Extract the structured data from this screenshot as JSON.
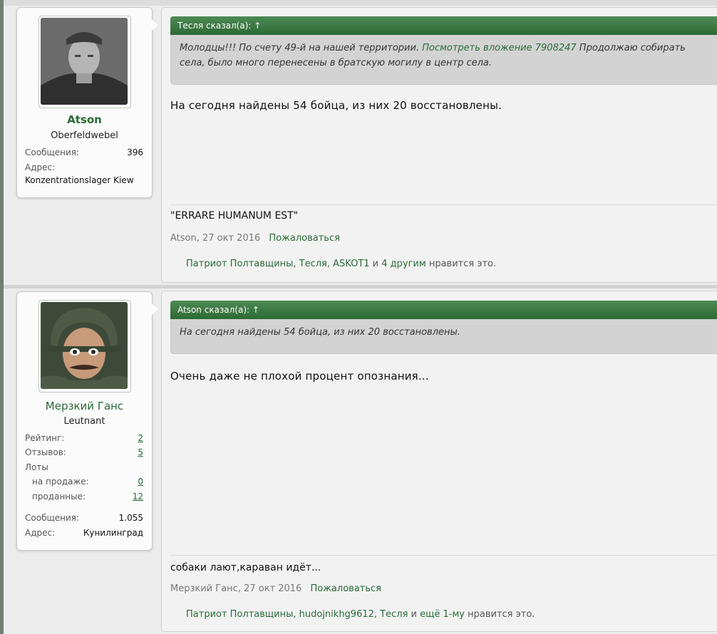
{
  "posts": [
    {
      "user": {
        "name": "Atson",
        "title": "Oberfeldwebel",
        "stats": [
          {
            "label": "Сообщения:",
            "value": "396"
          }
        ],
        "address_label": "Адрес:",
        "address_value": "Konzentrationslager Kiew"
      },
      "quote": {
        "header": "Тесля сказал(а): ↑",
        "line1_text": "Молодцы!!! По счету 49-й на нашей территории.",
        "line1_link": "Посмотреть вложение 7908247",
        "line1_tail": "Продолжаю собирать",
        "line2": "села, было много перенесены в братскую могилу в центр села."
      },
      "message": "На сегодня найдены 54 бойца, из них 20 восстановлены.",
      "signature": "\"ERRARE HUMANUM EST\"",
      "meta": {
        "author_date": "Atson, 27 окт 2016",
        "report": "Пожаловаться"
      },
      "likes": {
        "users": [
          "Патриот Полтавщины",
          "Тесля",
          "ASKOT1"
        ],
        "and": "и",
        "more": "4 другим",
        "tail": "нравится это."
      }
    },
    {
      "user": {
        "name": "Мерзкий Ганс",
        "title": "Leutnant",
        "rating_label": "Рейтинг:",
        "rating_value": "2",
        "reviews_label": "Отзывов:",
        "reviews_value": "5",
        "lots_label": "Лоты",
        "sale_label": "на продаже:",
        "sale_value": "0",
        "sold_label": "проданные:",
        "sold_value": "12",
        "messages_label": "Сообщения:",
        "messages_value": "1.055",
        "address_label": "Адрес:",
        "address_value": "Кунилинград"
      },
      "quote": {
        "header": "Atson сказал(а): ↑",
        "text": "На сегодня найдены 54 бойца, из них 20 восстановлены."
      },
      "message": "Очень даже не плохой процент опознания...",
      "signature": "собаки лают,караван идёт...",
      "meta": {
        "author_date": "Мерзкий Ганс, 27 окт 2016",
        "report": "Пожаловаться"
      },
      "likes": {
        "users": [
          "Патриот Полтавщины",
          "hudojnikhg9612",
          "Тесля"
        ],
        "and": "и",
        "more": "ещё 1-му",
        "tail": "нравится это."
      }
    }
  ],
  "colors": {
    "accent": "#2a6a38",
    "quote_header": "#3b7a43",
    "page_bg": "#e2e2e2"
  }
}
